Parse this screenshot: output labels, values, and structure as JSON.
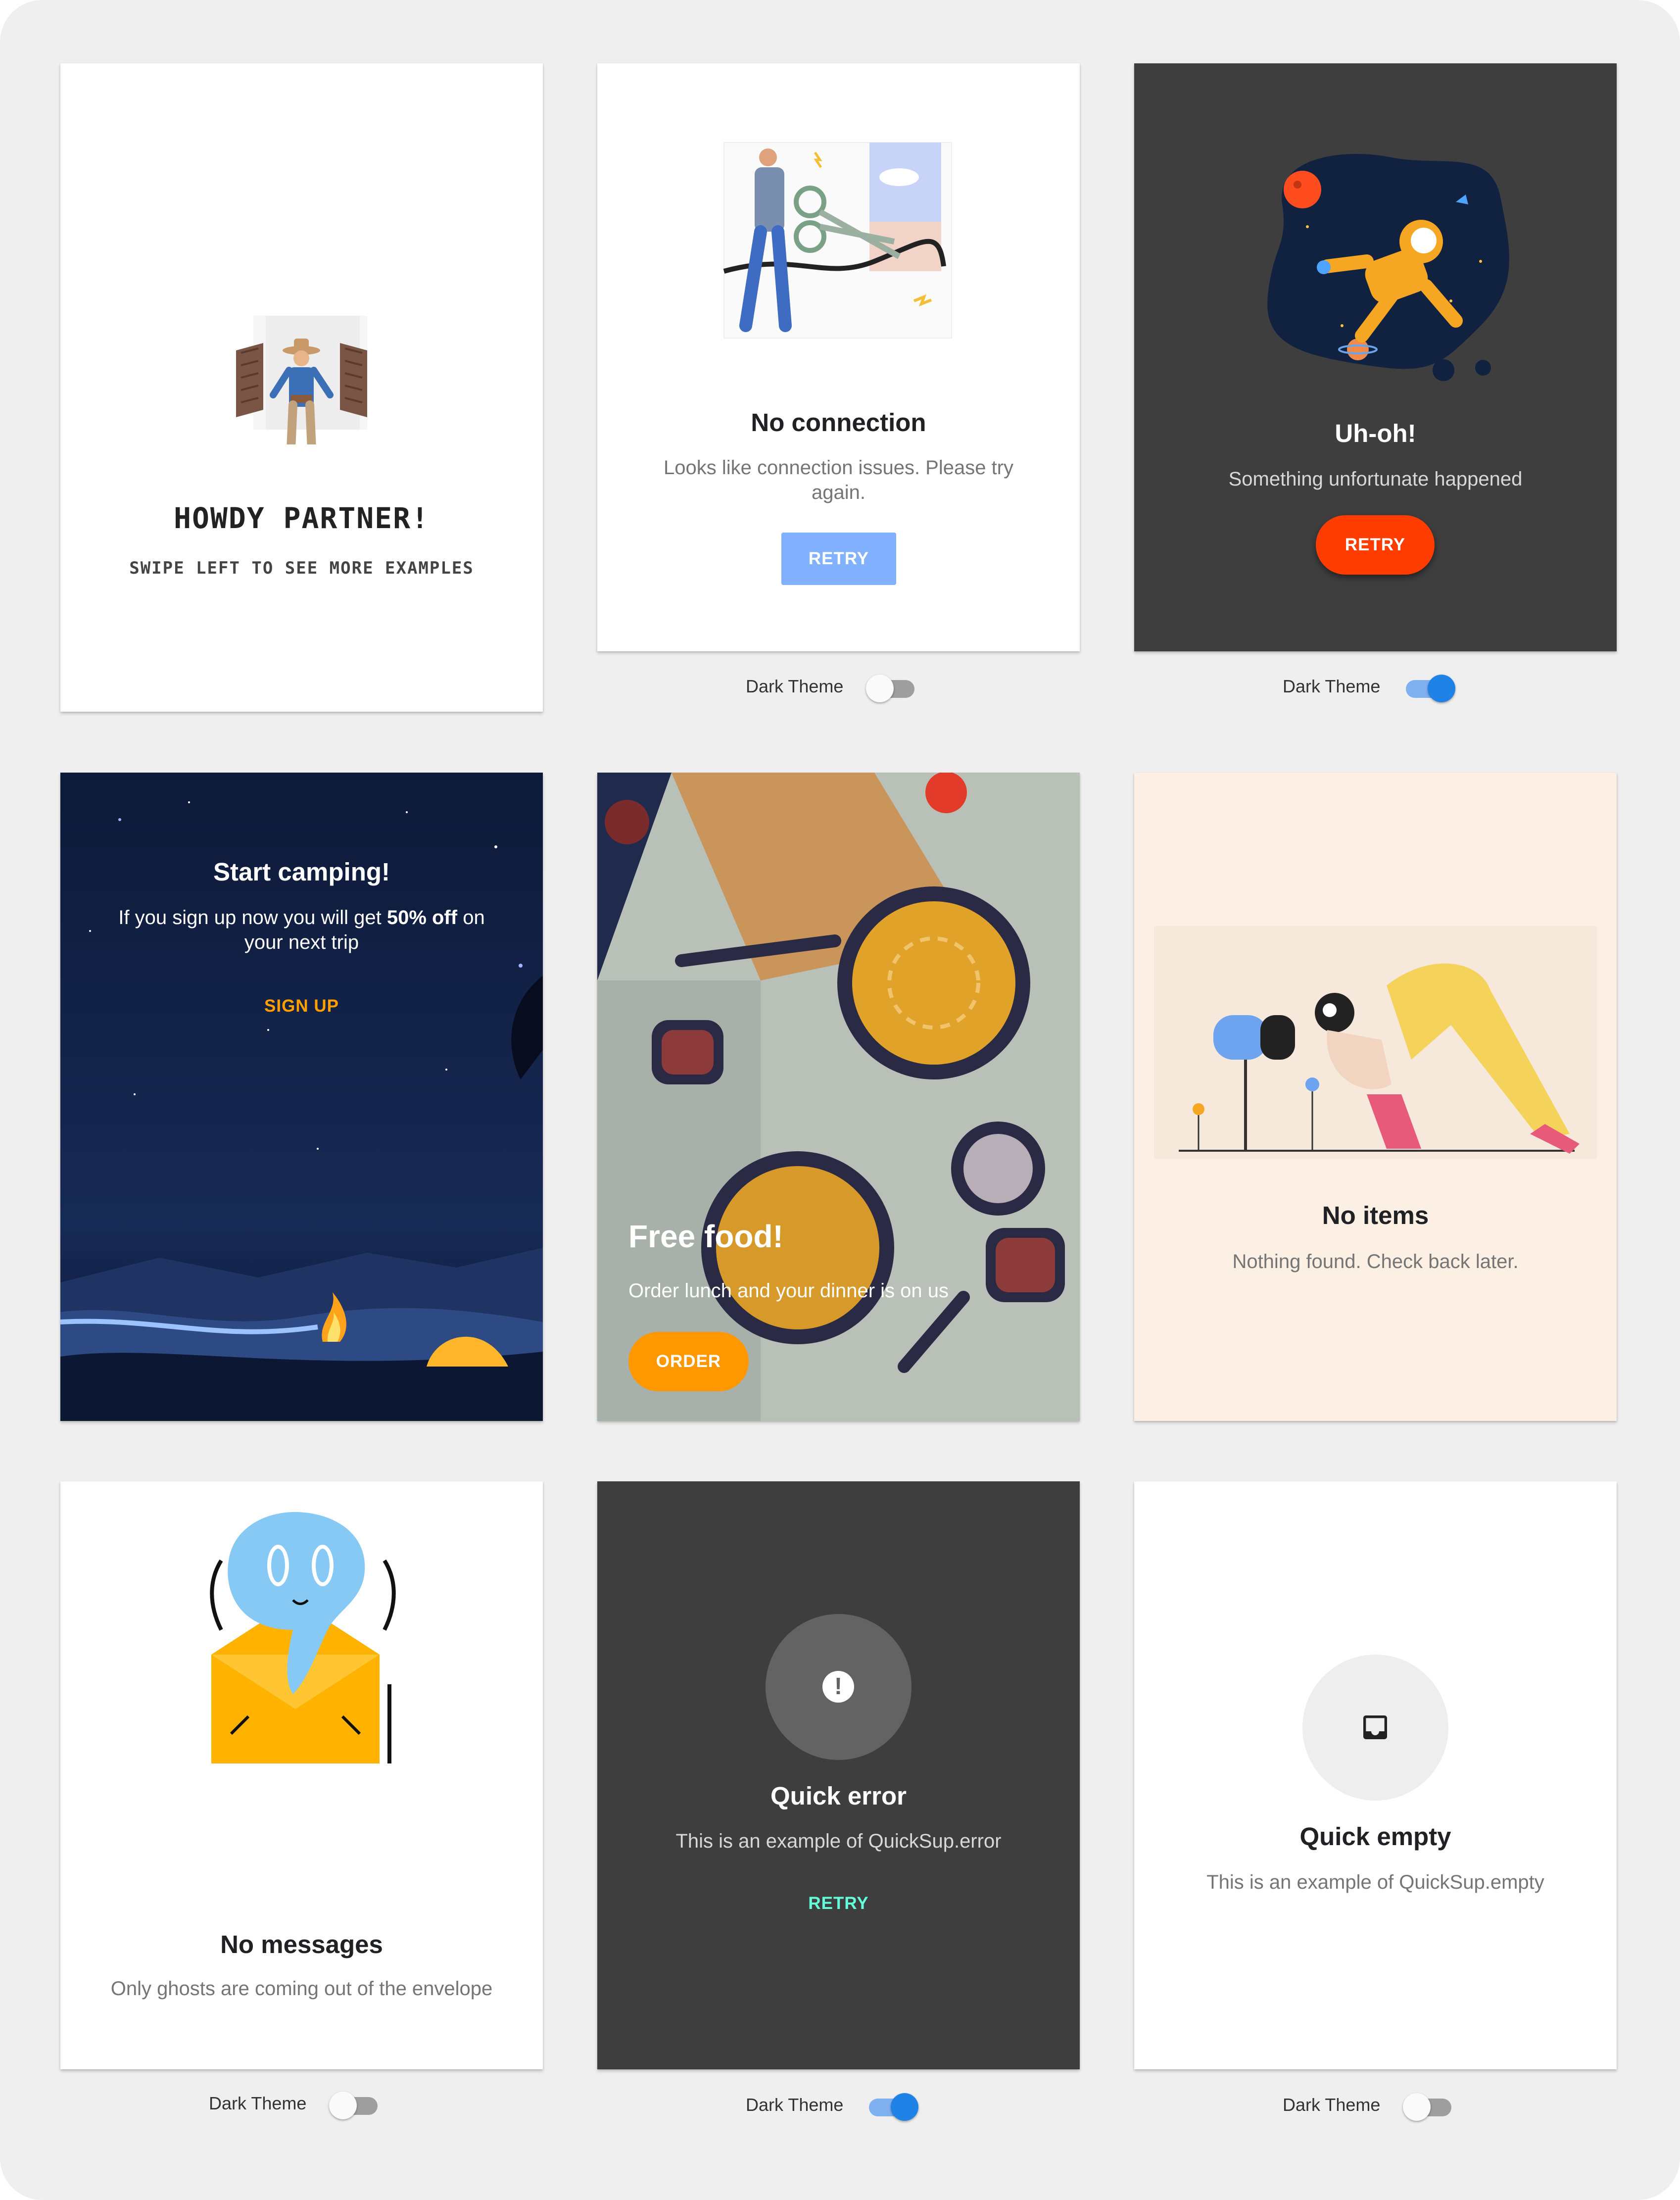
{
  "cards": {
    "howdy": {
      "title": "HOWDY PARTNER!",
      "subtitle": "SWIPE LEFT TO SEE MORE EXAMPLES"
    },
    "no_connection": {
      "title": "No connection",
      "subtitle_line1": "Looks like connection issues. Please try",
      "subtitle_line2": "again.",
      "button": "RETRY"
    },
    "uh_oh": {
      "title": "Uh-oh!",
      "subtitle": "Something unfortunate happened",
      "button": "RETRY"
    },
    "camping": {
      "title": "Start camping!",
      "subtitle_a": "If you sign up now you will get ",
      "subtitle_bold": "50% off",
      "subtitle_b": " on",
      "subtitle_line2": "your next trip",
      "button": "SIGN UP"
    },
    "food": {
      "title": "Free food!",
      "subtitle": "Order lunch and your dinner is on us",
      "button": "ORDER"
    },
    "no_items": {
      "title": "No items",
      "subtitle": "Nothing found. Check back later."
    },
    "no_messages": {
      "title": "No messages",
      "subtitle": "Only ghosts are coming out of the envelope"
    },
    "quick_error": {
      "title": "Quick error",
      "subtitle": "This is an example of QuickSup.error",
      "button": "RETRY"
    },
    "quick_empty": {
      "title": "Quick empty",
      "subtitle": "This is an example of QuickSup.empty"
    }
  },
  "toggles": {
    "row1_col2": {
      "label": "Dark Theme",
      "on": false
    },
    "row1_col3": {
      "label": "Dark Theme",
      "on": true
    },
    "row3_col1": {
      "label": "Dark Theme",
      "on": false
    },
    "row3_col2": {
      "label": "Dark Theme",
      "on": true
    },
    "row3_col3": {
      "label": "Dark Theme",
      "on": false
    }
  },
  "colors": {
    "background": "#efefef",
    "dark_card": "#3e3e3e",
    "accent_blue": "#1e82e6",
    "retry_light": "#82b1ff",
    "retry_orange": "#ff3d00",
    "order_orange": "#ff9800",
    "signup_orange": "#ffa000",
    "quick_retry": "#64ffda",
    "peach": "#fcefe3",
    "night_sky": "#0f1b3d"
  }
}
